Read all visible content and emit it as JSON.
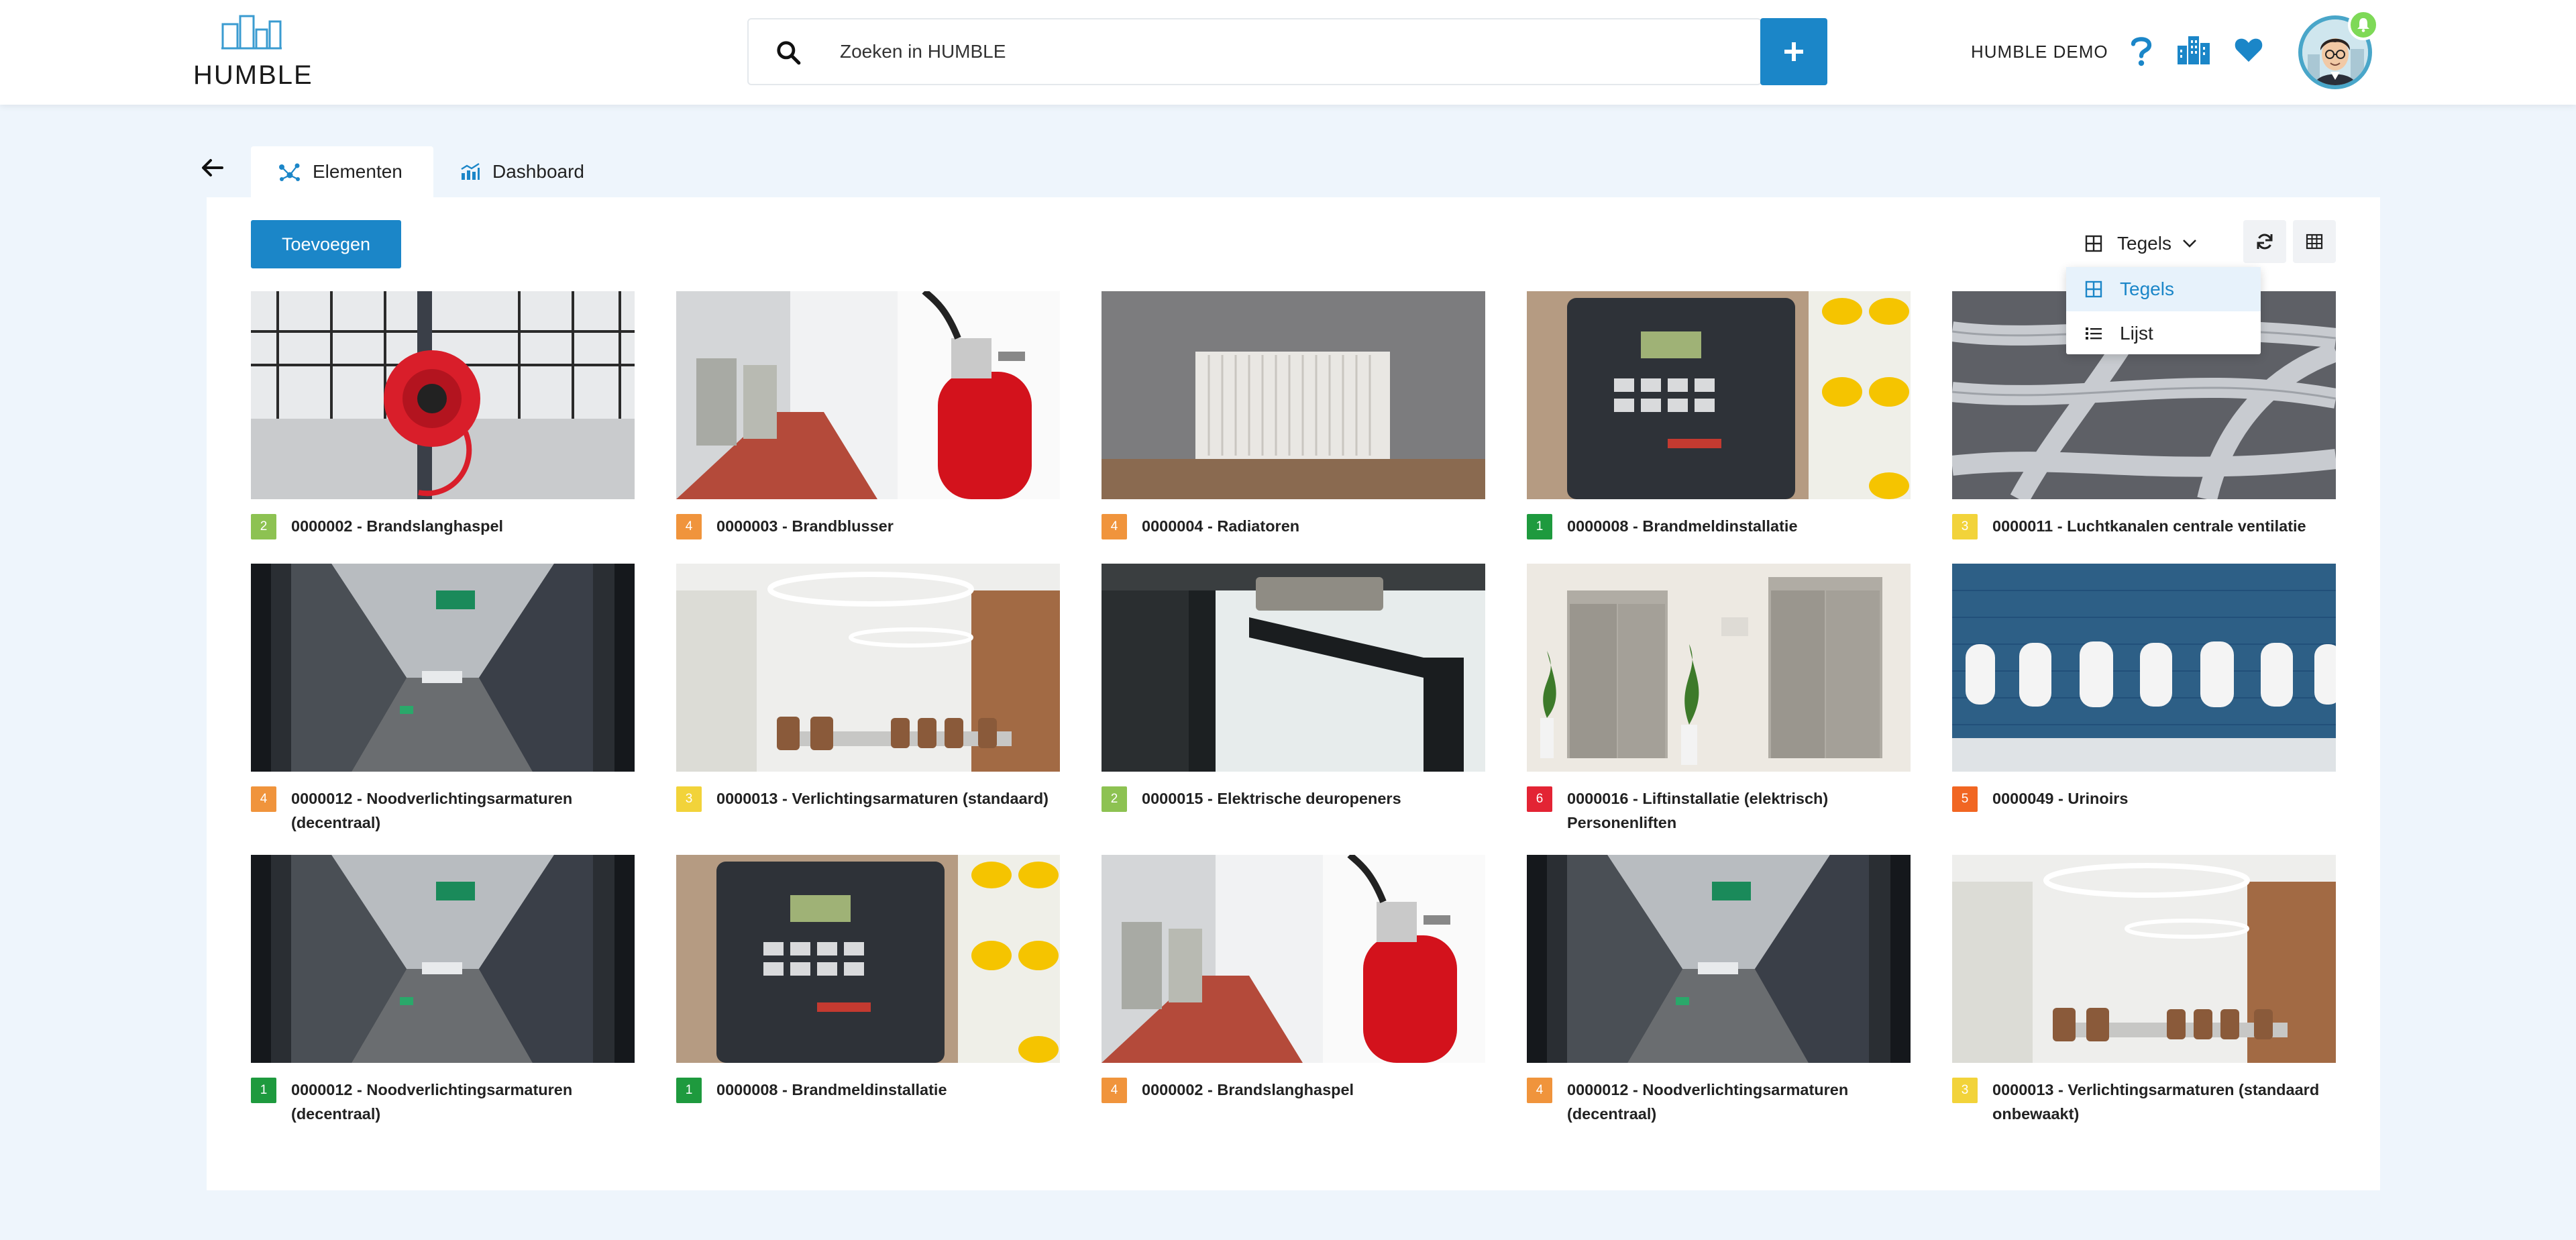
{
  "header": {
    "logo_text": "HUMBLE",
    "search_placeholder": "Zoeken in HUMBLE",
    "org_name": "HUMBLE DEMO",
    "add_symbol": "+"
  },
  "tabs": [
    {
      "label": "Elementen",
      "active": true,
      "icon": "network-icon"
    },
    {
      "label": "Dashboard",
      "active": false,
      "icon": "chart-icon"
    }
  ],
  "toolbar": {
    "add_label": "Toevoegen",
    "view_selected": "Tegels",
    "view_options": [
      "Tegels",
      "Lijst"
    ]
  },
  "colors": {
    "primary": "#1b86c8",
    "badge_1": "#1e9a3e",
    "badge_2": "#8dc252",
    "badge_3": "#f2d33a",
    "badge_4": "#f0943c",
    "badge_5": "#f16622",
    "badge_6": "#e32434"
  },
  "tiles": [
    {
      "score": "2",
      "title": "0000002 - Brandslanghaspel",
      "image": "fire-hose-reel"
    },
    {
      "score": "4",
      "title": "0000003 - Brandblusser",
      "image": "fire-extinguisher"
    },
    {
      "score": "4",
      "title": "0000004 - Radiatoren",
      "image": "radiator"
    },
    {
      "score": "1",
      "title": "0000008 - Brandmeldinstallatie",
      "image": "fire-alarm-panel"
    },
    {
      "score": "3",
      "title": "0000011 - Luchtkanalen centrale ventilatie",
      "image": "air-ducts"
    },
    {
      "score": "4",
      "title": "0000012 - Noodverlichtingsarmaturen (decentraal)",
      "image": "corridor-exit-sign"
    },
    {
      "score": "3",
      "title": "0000013 - Verlichtingsarmaturen (standaard)",
      "image": "meeting-room"
    },
    {
      "score": "2",
      "title": "0000015 - Elektrische deuropeners",
      "image": "door-closer"
    },
    {
      "score": "6",
      "title": "0000016 - Liftinstallatie (elektrisch) Personenliften",
      "image": "elevators"
    },
    {
      "score": "5",
      "title": "0000049 - Urinoirs",
      "image": "urinals"
    },
    {
      "score": "1",
      "title": "0000012 - Noodverlichtingsarmaturen (decentraal)",
      "image": "corridor-exit-sign"
    },
    {
      "score": "1",
      "title": "0000008 - Brandmeldinstallatie",
      "image": "fire-alarm-panel"
    },
    {
      "score": "4",
      "title": "0000002 - Brandslanghaspel",
      "image": "fire-extinguisher"
    },
    {
      "score": "4",
      "title": "0000012 - Noodverlichtingsarmaturen (decentraal)",
      "image": "corridor-exit-sign"
    },
    {
      "score": "3",
      "title": "0000013 - Verlichtingsarmaturen (standaard onbewaakt)",
      "image": "meeting-room"
    }
  ]
}
